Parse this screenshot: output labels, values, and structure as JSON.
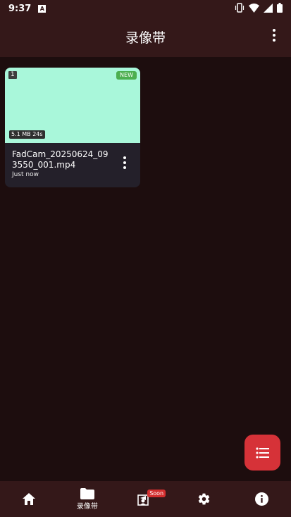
{
  "status_bar": {
    "time": "9:37",
    "notification_icon_letter": "A"
  },
  "app_bar": {
    "title": "录像带"
  },
  "videos": [
    {
      "index": "1",
      "badge": "NEW",
      "size_duration": "5.1 MB 24s",
      "file_name": "FadCam_20250624_093550_001.mp4",
      "time_ago": "Just now",
      "thumbnail_color": "#a9f7da"
    }
  ],
  "bottom_nav": {
    "records_label": "录像带",
    "soon_badge": "Soon"
  },
  "colors": {
    "app_bar": "#341819",
    "background": "#1d0d0e",
    "fab": "#d63238",
    "new_badge": "#4caf50"
  }
}
